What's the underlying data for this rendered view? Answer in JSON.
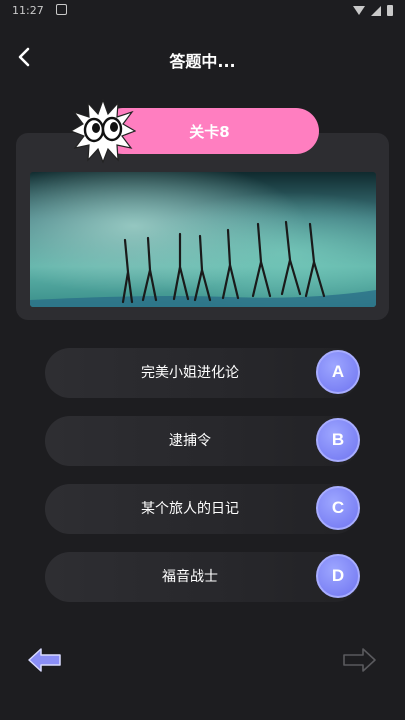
{
  "status_bar": {
    "time": "11:27"
  },
  "header": {
    "title": "答题中..."
  },
  "level": {
    "label": "关卡8"
  },
  "options": [
    {
      "letter": "A",
      "text": "完美小姐进化论"
    },
    {
      "letter": "B",
      "text": "逮捕令"
    },
    {
      "letter": "C",
      "text": "某个旅人的日记"
    },
    {
      "letter": "D",
      "text": "福音战士"
    }
  ],
  "colors": {
    "background": "#1d1d20",
    "level_pill": "#ff7ec0",
    "option_letter": "#7d83f5",
    "prev_arrow": "#8b8ff7"
  },
  "icons": {
    "back": "chevron-left-icon",
    "mascot": "googly-eyes-burst-icon",
    "prev": "arrow-left-icon",
    "next": "arrow-right-icon"
  }
}
